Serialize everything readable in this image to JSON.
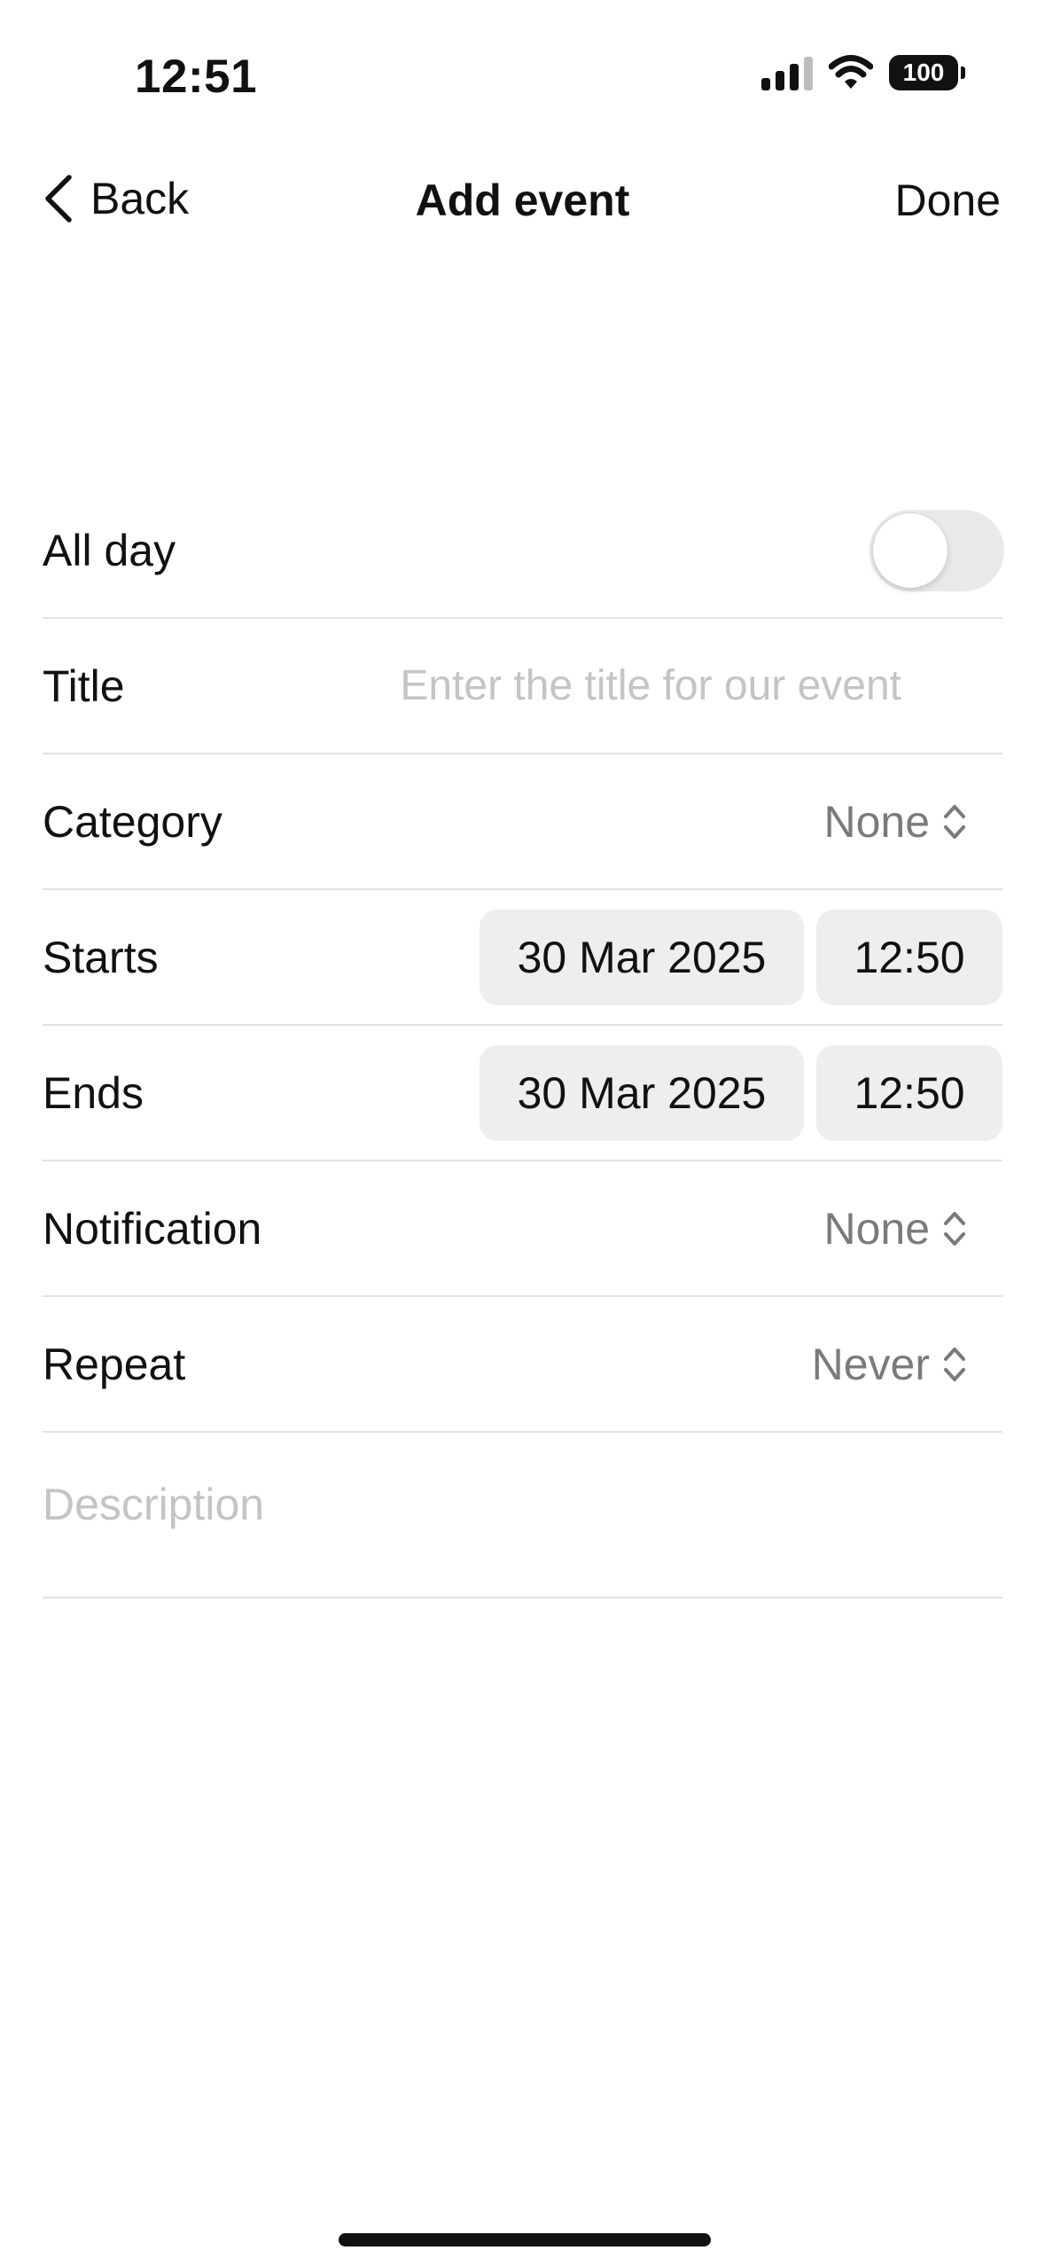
{
  "status_bar": {
    "time": "12:51",
    "battery": "100",
    "icons": [
      "cellular-signal-icon",
      "wifi-icon",
      "battery-icon"
    ]
  },
  "nav": {
    "back_label": "Back",
    "title": "Add event",
    "done_label": "Done"
  },
  "form": {
    "all_day": {
      "label": "All day",
      "value": false
    },
    "title": {
      "label": "Title",
      "placeholder": "Enter the title for our event",
      "value": ""
    },
    "category": {
      "label": "Category",
      "value": "None"
    },
    "starts": {
      "label": "Starts",
      "date": "30 Mar 2025",
      "time": "12:50"
    },
    "ends": {
      "label": "Ends",
      "date": "30 Mar 2025",
      "time": "12:50"
    },
    "notification": {
      "label": "Notification",
      "value": "None"
    },
    "repeat": {
      "label": "Repeat",
      "value": "Never"
    },
    "description": {
      "placeholder": "Description",
      "value": ""
    }
  },
  "colors": {
    "toggle_off": "#e9e9ea",
    "chip_bg": "#eeeeee",
    "secondary_text": "#7a7a7a",
    "placeholder": "#c4c4c4",
    "divider": "#e2e2e2"
  }
}
